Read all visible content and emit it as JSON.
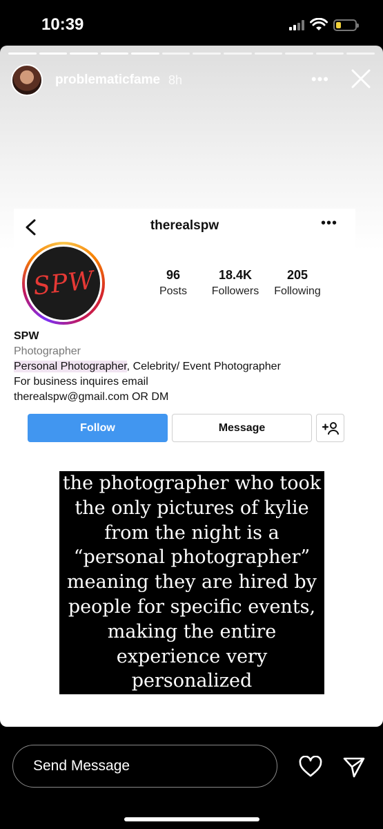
{
  "status_bar": {
    "time": "10:39"
  },
  "story": {
    "username": "problematicfame",
    "time_ago": "8h",
    "progress": {
      "segments_total": 12,
      "segments_viewed": 5
    }
  },
  "profile": {
    "username": "therealspw",
    "profile_pic_text": "SPW",
    "stats": [
      {
        "value": "96",
        "label": "Posts"
      },
      {
        "value": "18.4K",
        "label": "Followers"
      },
      {
        "value": "205",
        "label": "Following"
      }
    ],
    "bio": {
      "name": "SPW",
      "category": "Photographer",
      "line1_highlight": "Personal Photographer",
      "line1_rest": ", Celebrity/ Event Photographer",
      "line2": "For business inquires email",
      "line3": "therealspw@gmail.com OR DM"
    },
    "buttons": {
      "follow": "Follow",
      "message": "Message"
    }
  },
  "caption": {
    "lines": [
      "the photographer who took",
      "the only pictures of kylie",
      "from the night is a",
      "“personal photographer”",
      "meaning they are hired by",
      "people for specific events,",
      "making the entire",
      "experience very",
      "personalized"
    ]
  },
  "reply": {
    "placeholder": "Send Message"
  },
  "icons": {
    "more": "more-icon",
    "close": "close-icon",
    "back": "chevron-left-icon",
    "add_user": "add-user-icon",
    "heart": "heart-icon",
    "send": "send-icon"
  },
  "colors": {
    "follow_button": "#4196f0",
    "highlight": "#f1e4f2",
    "logo_text": "#e53935"
  }
}
